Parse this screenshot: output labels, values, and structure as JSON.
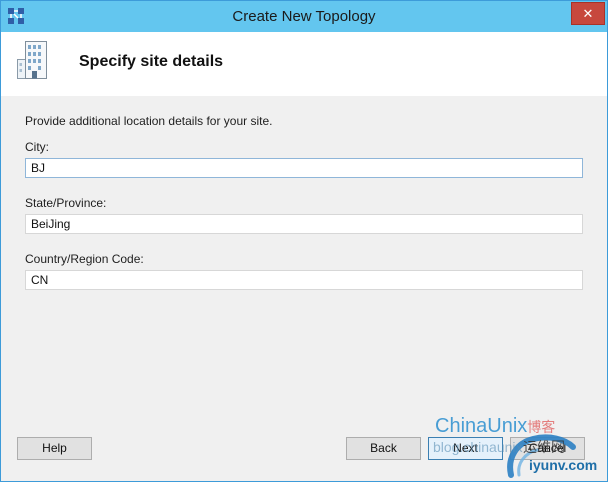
{
  "window": {
    "title": "Create New Topology",
    "close_glyph": "✕"
  },
  "header": {
    "title": "Specify site details",
    "icon": "building-icon"
  },
  "content": {
    "intro": "Provide additional location details for your site.",
    "fields": [
      {
        "label": "City:",
        "value": "BJ"
      },
      {
        "label": "State/Province:",
        "value": "BeiJing"
      },
      {
        "label": "Country/Region Code:",
        "value": "CN"
      }
    ]
  },
  "buttons": {
    "help": "Help",
    "back": "Back",
    "next": "Next",
    "cancel": "Cancel"
  },
  "watermark": {
    "brand": "ChinaUnix",
    "brand_cn": "博客",
    "url": "blog.chinaunix",
    "site_cn": "运维网",
    "site": "iyunv.com"
  },
  "colors": {
    "titlebar": "#63c6ef",
    "close": "#c7483d",
    "accent": "#3c7fb1"
  }
}
